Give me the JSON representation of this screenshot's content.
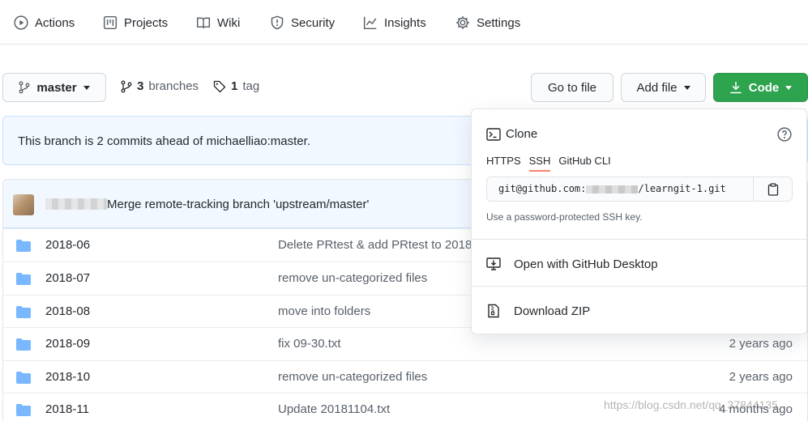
{
  "nav": {
    "actions": "Actions",
    "projects": "Projects",
    "wiki": "Wiki",
    "security": "Security",
    "insights": "Insights",
    "settings": "Settings"
  },
  "toolbar": {
    "branch": "master",
    "branch_count": "3",
    "branches_label": "branches",
    "tag_count": "1",
    "tag_label": "tag",
    "go_to_file": "Go to file",
    "add_file": "Add file",
    "code": "Code"
  },
  "banner": {
    "text": "This branch is 2 commits ahead of michaelliao:master."
  },
  "latest_commit": {
    "message": "Merge remote-tracking branch 'upstream/master'"
  },
  "files": [
    {
      "name": "2018-06",
      "message": "Delete PRtest & add PRtest to 2018",
      "age": ""
    },
    {
      "name": "2018-07",
      "message": "remove un-categorized files",
      "age": ""
    },
    {
      "name": "2018-08",
      "message": "move into folders",
      "age": ""
    },
    {
      "name": "2018-09",
      "message": "fix 09-30.txt",
      "age": "2 years ago"
    },
    {
      "name": "2018-10",
      "message": "remove un-categorized files",
      "age": "2 years ago"
    },
    {
      "name": "2018-11",
      "message": "Update 20181104.txt",
      "age": "4 months ago"
    }
  ],
  "clone": {
    "title": "Clone",
    "tabs": [
      "HTTPS",
      "SSH",
      "GitHub CLI"
    ],
    "active_tab": "SSH",
    "url_prefix": "git@github.com:",
    "url_suffix": "/learngit-1.git",
    "note": "Use a password-protected SSH key.",
    "open_desktop": "Open with GitHub Desktop",
    "download_zip": "Download ZIP"
  },
  "watermark": "https://blog.csdn.net/qq_37844135",
  "colors": {
    "primary_button": "#2ea44f",
    "folder": "#79b8ff",
    "banner_bg": "#f1f8ff",
    "active_tab_underline": "#f9826c"
  }
}
